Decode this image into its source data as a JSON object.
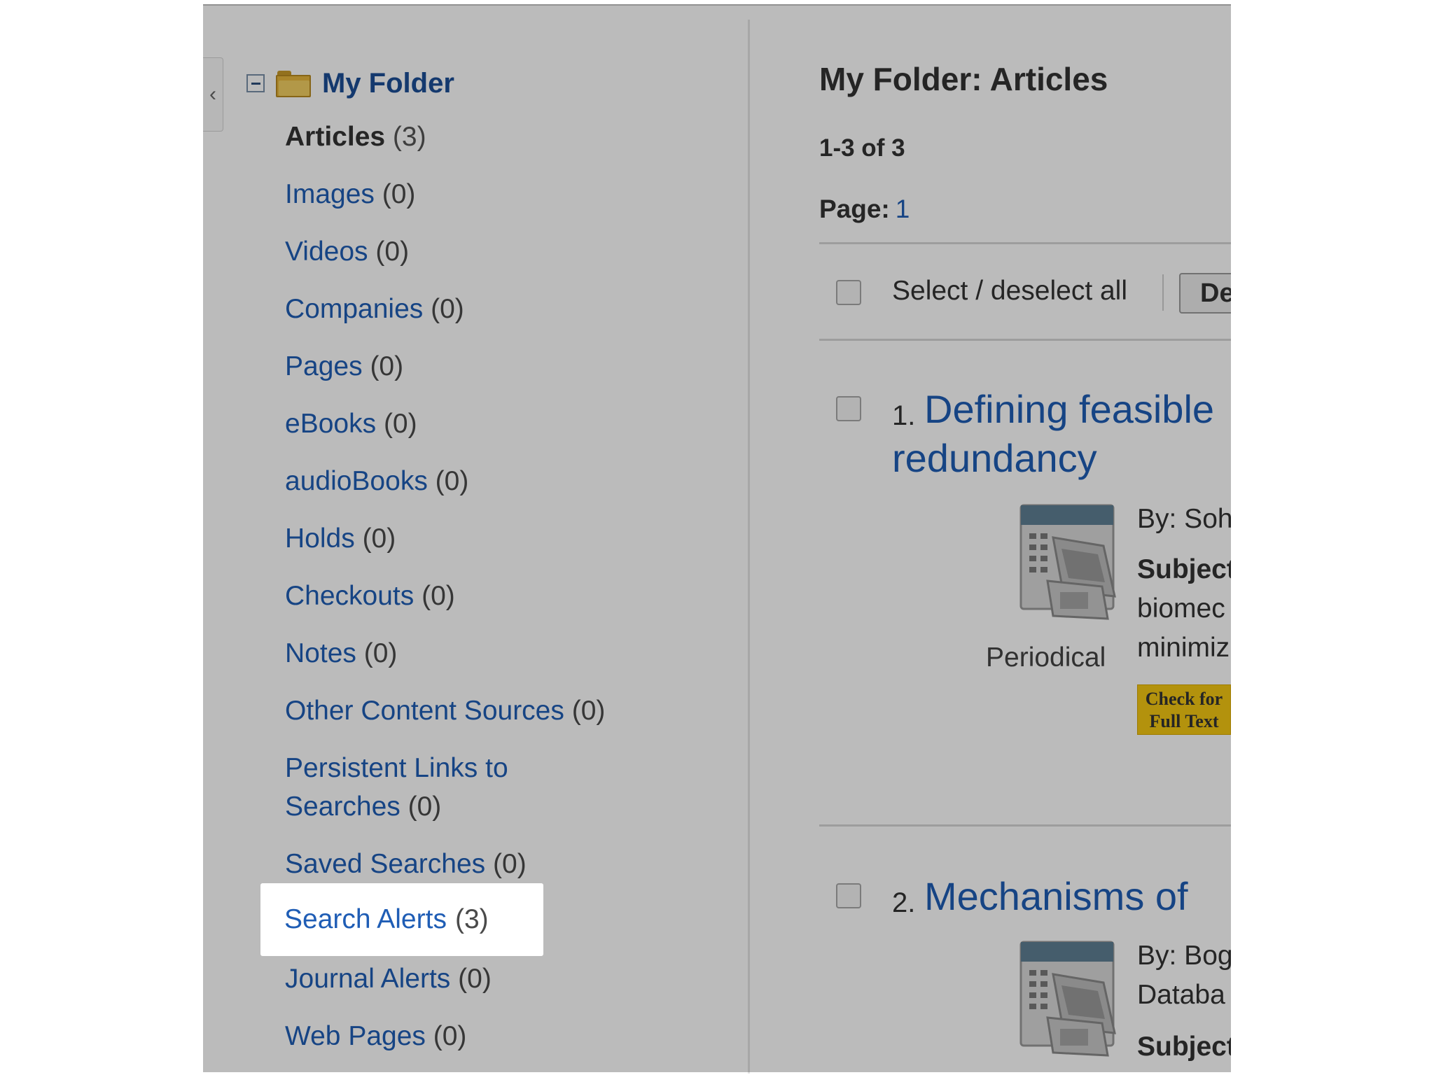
{
  "sidebar": {
    "collapse_glyph": "‹",
    "folder_title": "My Folder",
    "items": [
      {
        "label": "Articles",
        "count": "(3)",
        "active": true
      },
      {
        "label": "Images",
        "count": "(0)"
      },
      {
        "label": "Videos",
        "count": "(0)"
      },
      {
        "label": "Companies",
        "count": "(0)"
      },
      {
        "label": "Pages",
        "count": "(0)"
      },
      {
        "label": "eBooks",
        "count": "(0)"
      },
      {
        "label": "audioBooks",
        "count": "(0)"
      },
      {
        "label": "Holds",
        "count": "(0)"
      },
      {
        "label": "Checkouts",
        "count": "(0)"
      },
      {
        "label": "Notes",
        "count": "(0)"
      },
      {
        "label": "Other Content Sources",
        "count": "(0)"
      },
      {
        "label": "Persistent Links to Searches",
        "count": "(0)"
      },
      {
        "label": "Saved Searches",
        "count": "(0)"
      },
      {
        "label": "Search Alerts",
        "count": "(3)",
        "highlighted": true
      },
      {
        "label": "Journal Alerts",
        "count": "(0)"
      },
      {
        "label": "Web Pages",
        "count": "(0)"
      }
    ]
  },
  "main": {
    "title": "My Folder: Articles",
    "range": "1-3 of 3",
    "page_label": "Page:",
    "page_number": "1",
    "select_all_label": "Select / deselect all",
    "delete_button_label": "De",
    "results": [
      {
        "number": "1.",
        "title_line1": "Defining feasible",
        "title_line2": "redundancy",
        "pub_type": "Periodical",
        "meta_by": "By: Soh",
        "meta_subject_label": "Subject",
        "meta_line3": "biomec",
        "meta_line4": "minimiz",
        "fulltext_label": "Check for Full Text"
      },
      {
        "number": "2.",
        "title_line1": "Mechanisms of",
        "meta_by": "By: Bog",
        "meta_line2": "Databa",
        "meta_subject_label": "Subject"
      }
    ]
  },
  "colors": {
    "link": "#1f5db5",
    "overlay": "rgba(0,0,0,0.265)",
    "fulltext_badge": "#f5c712"
  },
  "icons": [
    "collapse-chevron-icon",
    "tree-minus-icon",
    "folder-icon",
    "periodical-icon"
  ]
}
